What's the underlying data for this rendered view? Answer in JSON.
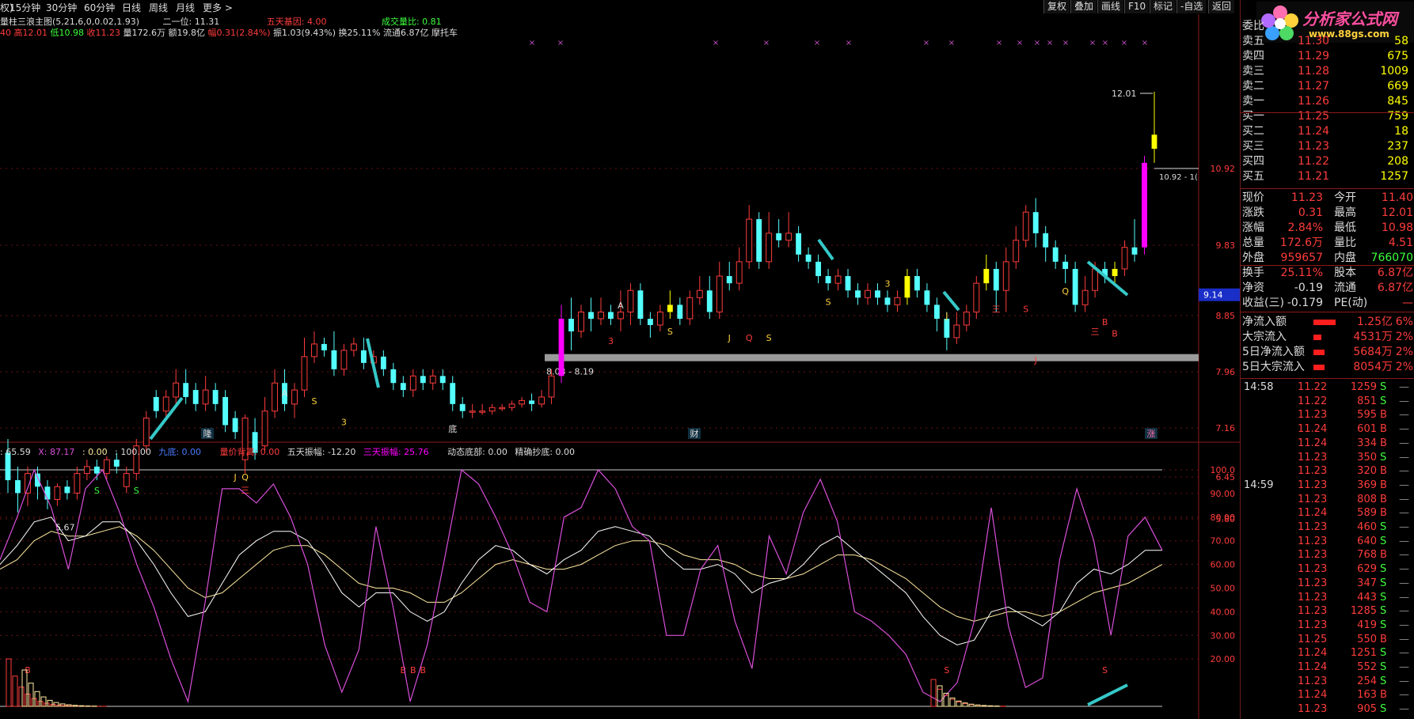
{
  "topbar": {
    "items": [
      "权)",
      "15分钟",
      "30分钟",
      "60分钟",
      "日线",
      "周线",
      "月线",
      "更多 >"
    ],
    "buttons": [
      "复权",
      "叠加",
      "画线",
      "F10",
      "标记",
      "-自选",
      "返回"
    ]
  },
  "info_line1": {
    "title": "量柱三浪主图",
    "params": "(5,21,6,0,0.02,1.93)",
    "l2": "二一位: 11.31",
    "l3": "五天基因: 4.00",
    "l4": "成交量比: 0.81"
  },
  "info_line2": {
    "high": "40 高12.01",
    "low": "低10.98",
    "close": "收11.23",
    "vol": "量172.6万",
    "amount": "额19.8亿",
    "chg": "幅0.31(2.84%)",
    "amp": "振1.03(9.43%)",
    "turn": "换25.11%",
    "float": "流通6.87亿",
    "name": "摩托车"
  },
  "indicator_header": {
    "a": ": 65.59",
    "b": "X: 87.17",
    "c": ": 0.00",
    "d": ": 100.00",
    "e": "九底: 0.00",
    "f": "量价背离: 0.00",
    "g": "五天振幅: -12.20",
    "h": "三天振幅: 25.76",
    "i": "动态底部: 0.00",
    "j": "精确抄底: 0.00"
  },
  "axis": {
    "price_ticks": [
      "10.92",
      "9.83",
      "8.85",
      "7.96",
      "7.16",
      "6.45",
      "5.80"
    ],
    "osc_ticks": [
      "100.0",
      "90.00",
      "80.00",
      "70.00",
      "60.00",
      "50.00",
      "40.00",
      "30.00",
      "20.00"
    ],
    "cur_price_tag": "9.14",
    "high_label": "12.01",
    "low_label": "5.67",
    "range_label": "8.03 - 8.19",
    "high_line_label": "10.92 - 1("
  },
  "chart_labels": {
    "bottom": [
      "隆",
      "财",
      "涨"
    ],
    "markers": [
      "A",
      "S",
      "3",
      "J",
      "Q",
      "三",
      "底",
      "A",
      "S",
      "3",
      "J",
      "Q",
      "S",
      "S",
      "3",
      "J",
      "三",
      "S",
      "J",
      "Q",
      "三",
      "B",
      "B",
      "B",
      "B",
      "B",
      "B",
      "S",
      "S",
      "S",
      "S"
    ]
  },
  "colors": {
    "up": "#ff3c3c",
    "down": "#54ffff",
    "magenta": "#ff00ff",
    "yellow": "#ffff00",
    "osc_k": "#d84fd8",
    "osc_d": "#ffffff",
    "osc_j": "#ffeaa0",
    "arrow": "#36c8c8"
  },
  "right_panel": {
    "brand": "分析家公式网",
    "site": "www.88gs.com",
    "book": [
      {
        "label": "委比",
        "price": "",
        "vol": ""
      },
      {
        "label": "卖五",
        "price": "11.30",
        "vol": "58"
      },
      {
        "label": "卖四",
        "price": "11.29",
        "vol": "675"
      },
      {
        "label": "卖三",
        "price": "11.28",
        "vol": "1009"
      },
      {
        "label": "卖二",
        "price": "11.27",
        "vol": "669"
      },
      {
        "label": "卖一",
        "price": "11.26",
        "vol": "845"
      },
      {
        "label": "买一",
        "price": "11.25",
        "vol": "759"
      },
      {
        "label": "买二",
        "price": "11.24",
        "vol": "18"
      },
      {
        "label": "买三",
        "price": "11.23",
        "vol": "237"
      },
      {
        "label": "买四",
        "price": "11.22",
        "vol": "208"
      },
      {
        "label": "买五",
        "price": "11.21",
        "vol": "1257"
      }
    ],
    "stats": [
      {
        "a": "现价",
        "b": "11.23",
        "c": "今开",
        "d": "11.40"
      },
      {
        "a": "涨跌",
        "b": "0.31",
        "c": "最高",
        "d": "12.01"
      },
      {
        "a": "涨幅",
        "b": "2.84%",
        "c": "最低",
        "d": "10.98"
      },
      {
        "a": "总量",
        "b": "172.6万",
        "c": "量比",
        "d": "4.51"
      },
      {
        "a": "外盘",
        "b": "959657",
        "c": "内盘",
        "d": "766070"
      },
      {
        "a": "换手",
        "b": "25.11%",
        "c": "股本",
        "d": "6.87亿"
      },
      {
        "a": "净资",
        "b": "-0.19",
        "c": "流通",
        "d": "6.87亿"
      },
      {
        "a": "收益(三)",
        "b": "-0.179",
        "c": "PE(动)",
        "d": "—"
      }
    ],
    "flows": [
      {
        "a": "净流入额",
        "v": "1.25亿",
        "p": "6%"
      },
      {
        "a": "大宗流入",
        "v": "4531万",
        "p": "2%"
      },
      {
        "a": "5日净流入额",
        "v": "5684万",
        "p": "2%"
      },
      {
        "a": "5日大宗流入",
        "v": "8054万",
        "p": "2%"
      }
    ],
    "ticks": [
      {
        "t": "14:58",
        "p": "11.22",
        "v": "1259",
        "bs": "S"
      },
      {
        "t": "",
        "p": "11.22",
        "v": "851",
        "bs": "S"
      },
      {
        "t": "",
        "p": "11.23",
        "v": "595",
        "bs": "B"
      },
      {
        "t": "",
        "p": "11.24",
        "v": "601",
        "bs": "B"
      },
      {
        "t": "",
        "p": "11.24",
        "v": "334",
        "bs": "B"
      },
      {
        "t": "",
        "p": "11.23",
        "v": "350",
        "bs": "S"
      },
      {
        "t": "",
        "p": "11.23",
        "v": "320",
        "bs": "B"
      },
      {
        "t": "14:59",
        "p": "11.23",
        "v": "369",
        "bs": "B"
      },
      {
        "t": "",
        "p": "11.23",
        "v": "808",
        "bs": "B"
      },
      {
        "t": "",
        "p": "11.24",
        "v": "589",
        "bs": "B"
      },
      {
        "t": "",
        "p": "11.23",
        "v": "460",
        "bs": "S"
      },
      {
        "t": "",
        "p": "11.23",
        "v": "640",
        "bs": "S"
      },
      {
        "t": "",
        "p": "11.23",
        "v": "768",
        "bs": "B"
      },
      {
        "t": "",
        "p": "11.23",
        "v": "629",
        "bs": "S"
      },
      {
        "t": "",
        "p": "11.23",
        "v": "347",
        "bs": "S"
      },
      {
        "t": "",
        "p": "11.23",
        "v": "443",
        "bs": "S"
      },
      {
        "t": "",
        "p": "11.23",
        "v": "1285",
        "bs": "S"
      },
      {
        "t": "",
        "p": "11.23",
        "v": "419",
        "bs": "S"
      },
      {
        "t": "",
        "p": "11.25",
        "v": "550",
        "bs": "B"
      },
      {
        "t": "",
        "p": "11.24",
        "v": "1251",
        "bs": "S"
      },
      {
        "t": "",
        "p": "11.24",
        "v": "552",
        "bs": "S"
      },
      {
        "t": "",
        "p": "11.23",
        "v": "254",
        "bs": "S"
      },
      {
        "t": "",
        "p": "11.24",
        "v": "163",
        "bs": "B"
      },
      {
        "t": "",
        "p": "11.23",
        "v": "905",
        "bs": "S"
      }
    ]
  },
  "chart_data": {
    "type": "candlestick",
    "price_axis": [
      5.8,
      6.45,
      7.16,
      7.96,
      8.85,
      9.83,
      10.92
    ],
    "osc_axis": [
      0,
      100
    ],
    "candles": [
      [
        6.8,
        6.4,
        7.0,
        6.2
      ],
      [
        6.4,
        6.2,
        6.6,
        5.9
      ],
      [
        6.2,
        6.5,
        6.6,
        6.0
      ],
      [
        6.5,
        6.3,
        6.6,
        6.1
      ],
      [
        6.3,
        6.1,
        6.4,
        5.95
      ],
      [
        6.1,
        6.3,
        6.35,
        6.0
      ],
      [
        6.3,
        6.2,
        6.4,
        6.1
      ],
      [
        6.2,
        6.5,
        6.6,
        6.1
      ],
      [
        6.5,
        6.6,
        6.7,
        6.4
      ],
      [
        6.6,
        6.5,
        6.7,
        6.4
      ],
      [
        6.5,
        6.7,
        6.75,
        6.4
      ],
      [
        6.7,
        6.6,
        6.8,
        6.5
      ],
      [
        6.3,
        6.5,
        6.6,
        6.2
      ],
      [
        6.5,
        6.9,
        7.0,
        6.4
      ],
      [
        6.9,
        7.3,
        7.4,
        6.8
      ],
      [
        7.6,
        7.4,
        7.7,
        7.3
      ],
      [
        7.4,
        7.6,
        7.7,
        7.3
      ],
      [
        7.6,
        7.8,
        8.0,
        7.5
      ],
      [
        7.8,
        7.6,
        8.0,
        7.5
      ],
      [
        7.7,
        7.5,
        7.8,
        7.4
      ],
      [
        7.5,
        7.7,
        7.9,
        7.4
      ],
      [
        7.7,
        7.5,
        7.8,
        7.4
      ],
      [
        7.6,
        7.2,
        7.7,
        7.1
      ],
      [
        7.3,
        7.1,
        7.4,
        7.0
      ],
      [
        6.7,
        7.3,
        7.35,
        6.5
      ],
      [
        7.1,
        6.8,
        7.3,
        6.7
      ],
      [
        6.9,
        7.4,
        7.6,
        6.8
      ],
      [
        7.4,
        7.8,
        8.0,
        7.3
      ],
      [
        7.8,
        7.5,
        8.0,
        7.4
      ],
      [
        7.5,
        7.7,
        7.8,
        7.3
      ],
      [
        7.7,
        8.2,
        8.5,
        7.6
      ],
      [
        8.2,
        8.4,
        8.6,
        8.1
      ],
      [
        8.4,
        8.3,
        8.5,
        8.2
      ],
      [
        8.3,
        8.0,
        8.6,
        7.9
      ],
      [
        8.0,
        8.3,
        8.4,
        7.9
      ],
      [
        8.3,
        8.4,
        8.5,
        8.2
      ],
      [
        8.3,
        8.1,
        8.5,
        8.0
      ],
      [
        8.1,
        8.2,
        8.3,
        8.0
      ],
      [
        8.2,
        8.0,
        8.3,
        7.9
      ],
      [
        8.0,
        7.8,
        8.1,
        7.7
      ],
      [
        7.8,
        7.7,
        7.9,
        7.6
      ],
      [
        7.7,
        7.9,
        8.0,
        7.6
      ],
      [
        7.9,
        7.8,
        8.0,
        7.7
      ],
      [
        7.8,
        7.9,
        8.0,
        7.7
      ],
      [
        7.9,
        7.8,
        8.0,
        7.7
      ],
      [
        7.8,
        7.5,
        7.9,
        7.4
      ],
      [
        7.5,
        7.4,
        7.6,
        7.3
      ],
      [
        7.4,
        7.4,
        7.5,
        7.3
      ],
      [
        7.4,
        7.4,
        7.5,
        7.35
      ],
      [
        7.4,
        7.45,
        7.5,
        7.35
      ],
      [
        7.45,
        7.45,
        7.5,
        7.4
      ],
      [
        7.45,
        7.5,
        7.55,
        7.4
      ],
      [
        7.5,
        7.55,
        7.6,
        7.45
      ],
      [
        7.55,
        7.5,
        7.65,
        7.4
      ],
      [
        7.5,
        7.6,
        7.7,
        7.45
      ],
      [
        7.6,
        7.9,
        8.0,
        7.5
      ],
      [
        7.9,
        8.8,
        9.0,
        7.8
      ],
      [
        8.8,
        8.6,
        9.1,
        8.3
      ],
      [
        8.6,
        8.9,
        9.0,
        8.5
      ],
      [
        8.9,
        8.8,
        9.1,
        8.6
      ],
      [
        8.8,
        8.9,
        9.1,
        8.7
      ],
      [
        8.9,
        8.8,
        9.0,
        8.7
      ],
      [
        8.8,
        8.9,
        9.2,
        8.6
      ],
      [
        8.9,
        9.2,
        9.3,
        8.7
      ],
      [
        9.2,
        8.8,
        9.3,
        8.7
      ],
      [
        8.8,
        8.7,
        8.9,
        8.5
      ],
      [
        8.7,
        8.9,
        9.0,
        8.6
      ],
      [
        8.9,
        9.0,
        9.2,
        8.8
      ],
      [
        9.0,
        8.8,
        9.1,
        8.7
      ],
      [
        8.8,
        9.1,
        9.2,
        8.7
      ],
      [
        9.1,
        9.2,
        9.4,
        9.0
      ],
      [
        9.2,
        8.9,
        9.4,
        8.8
      ],
      [
        8.9,
        9.4,
        9.6,
        8.8
      ],
      [
        9.4,
        9.3,
        9.6,
        9.2
      ],
      [
        9.3,
        9.6,
        9.8,
        9.2
      ],
      [
        9.6,
        10.2,
        10.4,
        9.5
      ],
      [
        10.2,
        9.6,
        10.3,
        9.5
      ],
      [
        9.6,
        10.0,
        10.3,
        9.5
      ],
      [
        10.0,
        9.9,
        10.2,
        9.8
      ],
      [
        9.9,
        10.0,
        10.3,
        9.8
      ],
      [
        10.0,
        9.7,
        10.1,
        9.6
      ],
      [
        9.7,
        9.6,
        9.8,
        9.5
      ],
      [
        9.6,
        9.4,
        9.7,
        9.3
      ],
      [
        9.4,
        9.3,
        9.5,
        9.2
      ],
      [
        9.3,
        9.4,
        9.5,
        9.2
      ],
      [
        9.4,
        9.2,
        9.5,
        9.1
      ],
      [
        9.2,
        9.1,
        9.3,
        9.0
      ],
      [
        9.1,
        9.2,
        9.3,
        9.0
      ],
      [
        9.2,
        9.1,
        9.3,
        9.0
      ],
      [
        9.1,
        9.0,
        9.2,
        8.9
      ],
      [
        9.0,
        9.1,
        9.2,
        8.9
      ],
      [
        9.1,
        9.4,
        9.5,
        9.0
      ],
      [
        9.4,
        9.2,
        9.5,
        9.1
      ],
      [
        9.2,
        9.0,
        9.3,
        8.9
      ],
      [
        9.0,
        8.8,
        9.1,
        8.6
      ],
      [
        8.8,
        8.5,
        8.9,
        8.3
      ],
      [
        8.5,
        8.7,
        8.9,
        8.4
      ],
      [
        8.7,
        8.9,
        9.0,
        8.6
      ],
      [
        8.9,
        9.3,
        9.4,
        8.8
      ],
      [
        9.3,
        9.5,
        9.7,
        9.2
      ],
      [
        9.5,
        9.2,
        9.6,
        8.9
      ],
      [
        9.2,
        9.6,
        9.8,
        8.9
      ],
      [
        9.6,
        9.9,
        10.1,
        9.5
      ],
      [
        9.9,
        10.3,
        10.4,
        9.8
      ],
      [
        10.3,
        10.0,
        10.5,
        9.8
      ],
      [
        10.0,
        9.8,
        10.1,
        9.6
      ],
      [
        9.8,
        9.6,
        9.9,
        9.5
      ],
      [
        9.6,
        9.5,
        9.7,
        9.3
      ],
      [
        9.5,
        9.0,
        9.6,
        8.9
      ],
      [
        9.0,
        9.2,
        9.4,
        8.9
      ],
      [
        9.2,
        9.5,
        9.6,
        9.1
      ],
      [
        9.5,
        9.4,
        9.6,
        9.3
      ],
      [
        9.4,
        9.5,
        9.6,
        9.3
      ],
      [
        9.5,
        9.8,
        9.9,
        9.4
      ],
      [
        9.8,
        9.7,
        10.2,
        9.6
      ],
      [
        9.8,
        11.0,
        11.1,
        9.7
      ],
      [
        11.2,
        11.4,
        12.01,
        11.0
      ]
    ],
    "osc_k": [
      62,
      80,
      100,
      84,
      58,
      92,
      100,
      82,
      60,
      42,
      20,
      2,
      44,
      92,
      92,
      86,
      94,
      80,
      60,
      26,
      6,
      24,
      76,
      42,
      2,
      26,
      62,
      100,
      94,
      80,
      64,
      44,
      40,
      80,
      84,
      100,
      92,
      76,
      70,
      30,
      30,
      58,
      68,
      36,
      16,
      72,
      56,
      82,
      96,
      78,
      40,
      36,
      30,
      22,
      6,
      2,
      10,
      36,
      84,
      34,
      8,
      12,
      62,
      92,
      70,
      30,
      72,
      80,
      66
    ],
    "osc_d": [
      60,
      68,
      78,
      80,
      70,
      72,
      78,
      78,
      70,
      60,
      48,
      38,
      40,
      52,
      64,
      70,
      74,
      74,
      70,
      60,
      48,
      42,
      48,
      48,
      40,
      36,
      40,
      52,
      62,
      68,
      66,
      60,
      56,
      62,
      66,
      74,
      76,
      74,
      72,
      64,
      58,
      58,
      60,
      56,
      48,
      52,
      54,
      60,
      68,
      72,
      66,
      60,
      54,
      48,
      38,
      30,
      26,
      28,
      40,
      42,
      38,
      34,
      40,
      52,
      58,
      56,
      60,
      66,
      66
    ],
    "osc_j": [
      58,
      62,
      70,
      74,
      72,
      72,
      74,
      76,
      72,
      66,
      58,
      50,
      46,
      48,
      54,
      60,
      66,
      68,
      68,
      64,
      58,
      52,
      50,
      50,
      48,
      44,
      44,
      48,
      54,
      60,
      62,
      60,
      58,
      58,
      60,
      64,
      68,
      70,
      70,
      68,
      64,
      62,
      62,
      60,
      56,
      54,
      54,
      56,
      60,
      64,
      64,
      62,
      58,
      54,
      48,
      42,
      38,
      36,
      38,
      40,
      40,
      38,
      40,
      44,
      48,
      50,
      52,
      56,
      60
    ]
  }
}
